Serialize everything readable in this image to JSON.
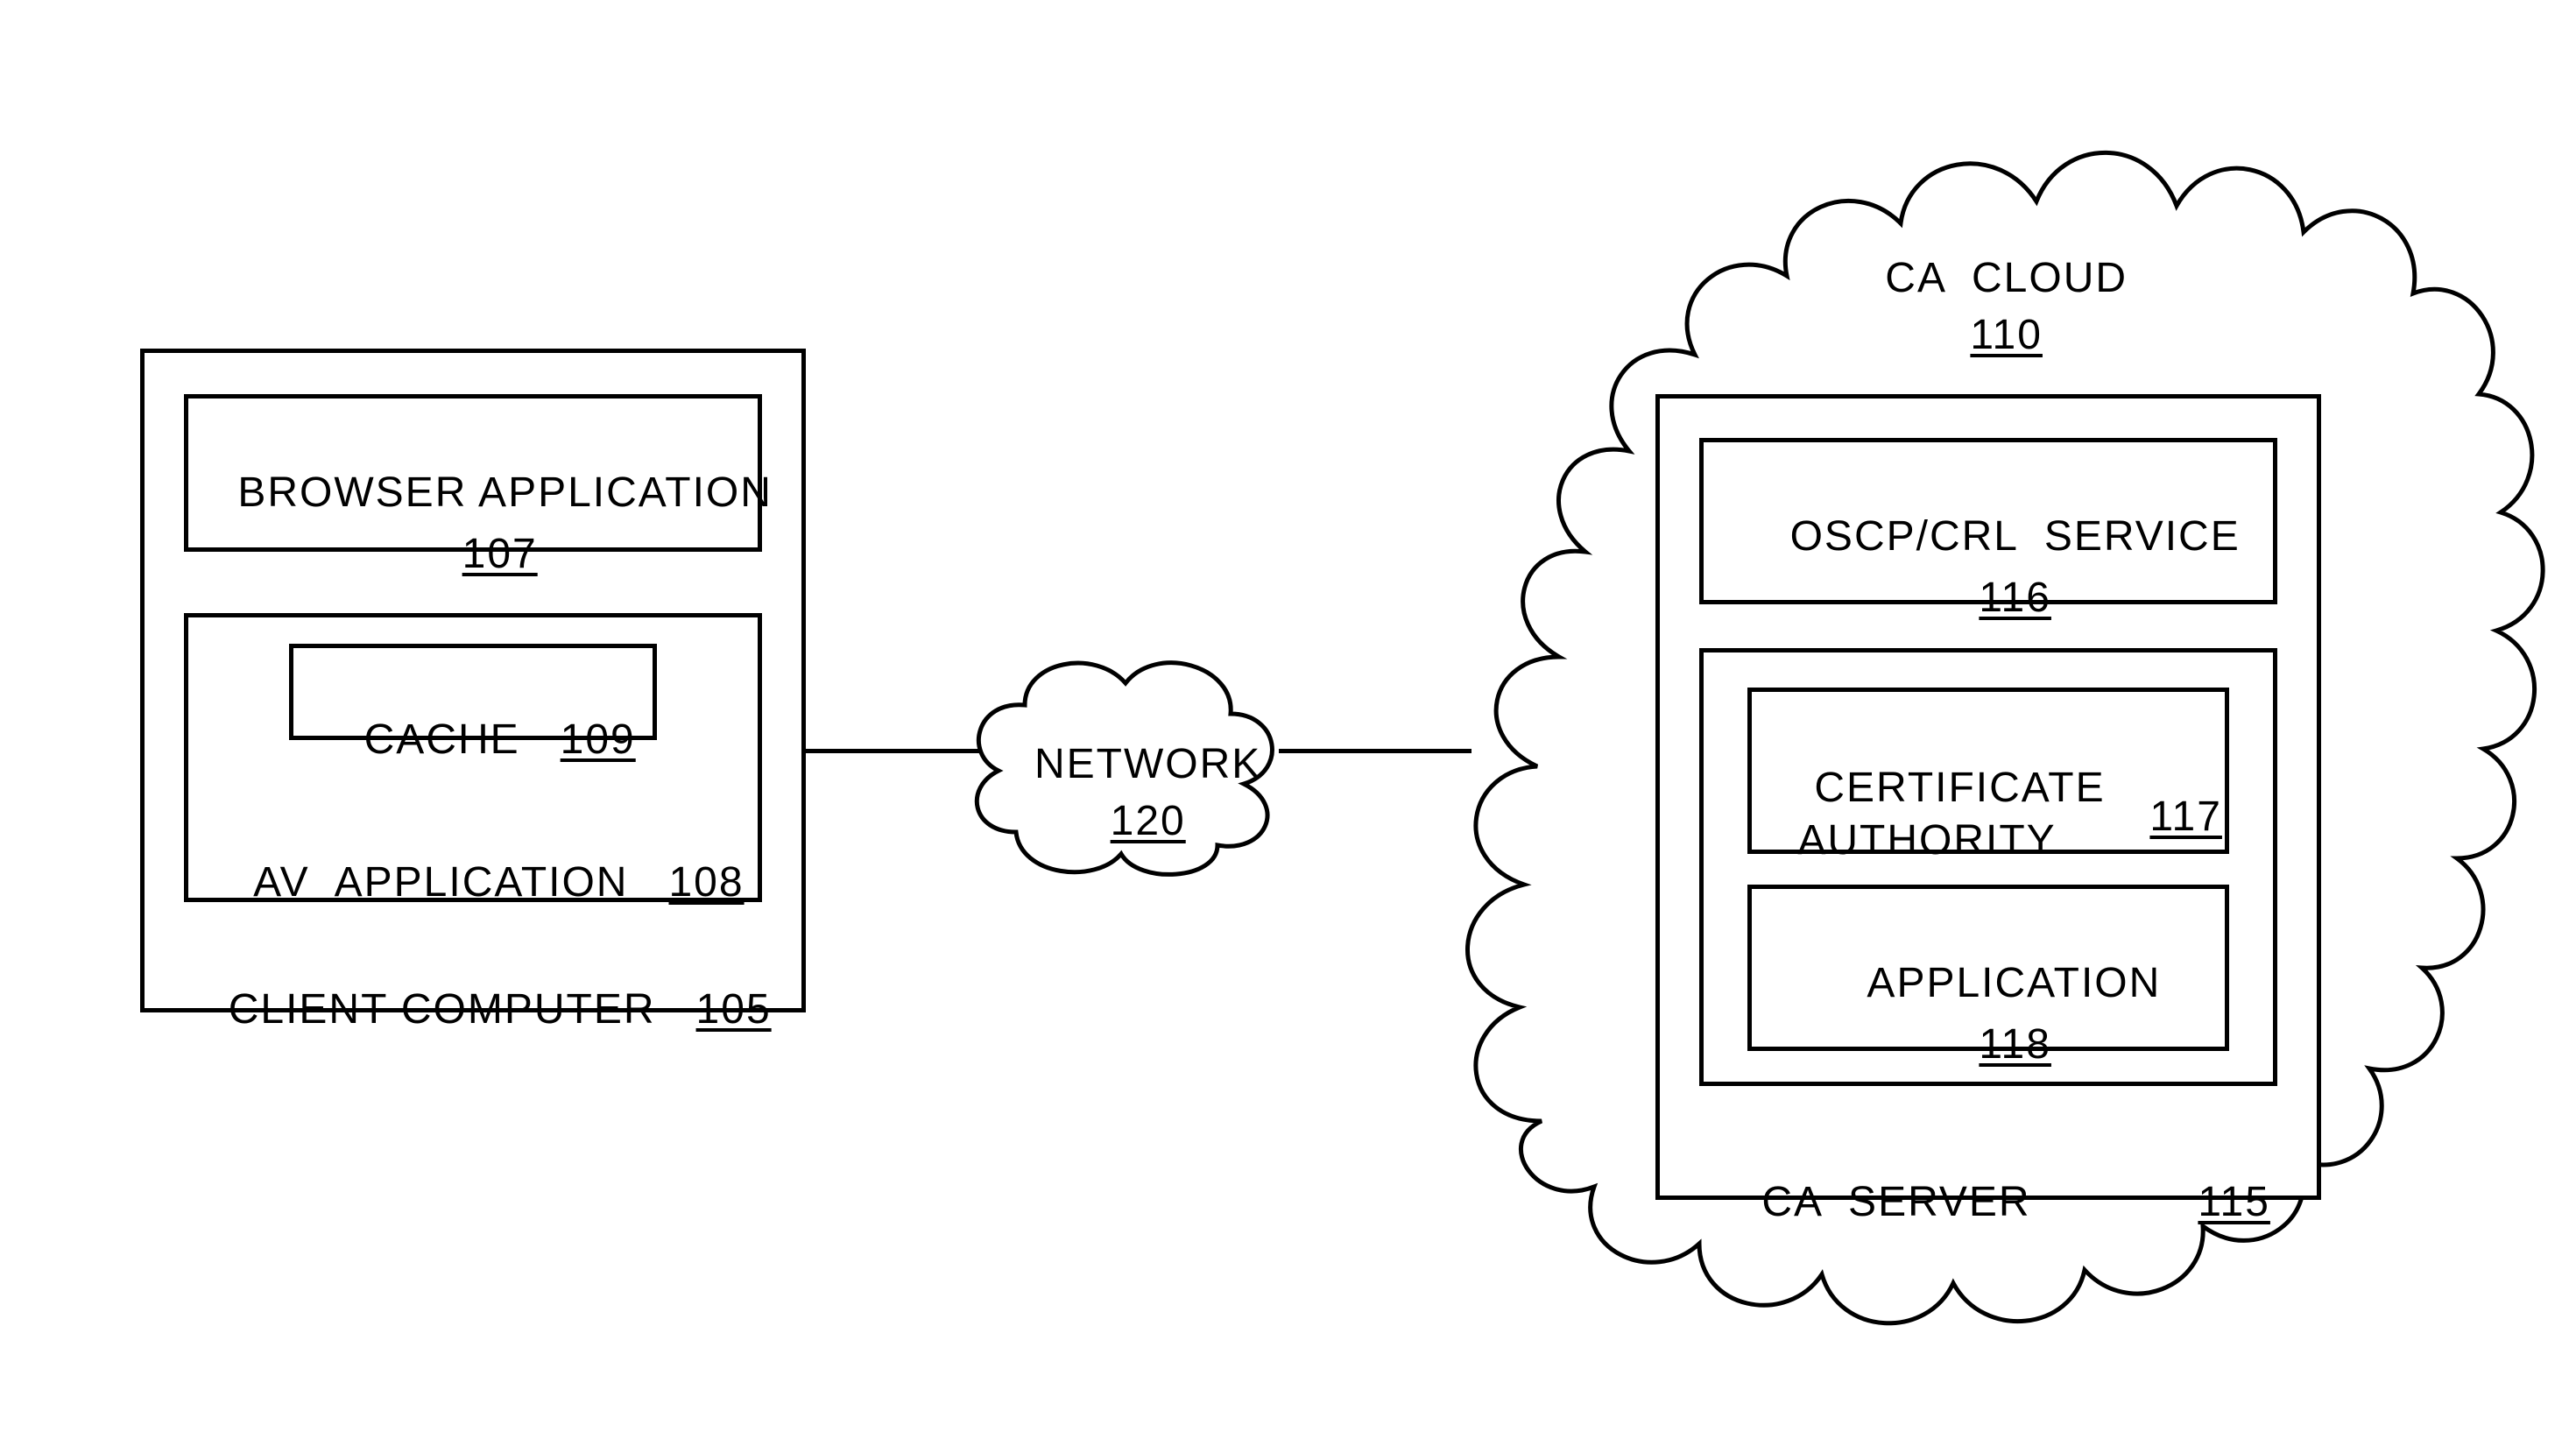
{
  "client": {
    "title": "CLIENT COMPUTER",
    "num": "105",
    "browser": {
      "title": "BROWSER APPLICATION",
      "num": "107"
    },
    "av": {
      "title": "AV  APPLICATION",
      "num": "108",
      "cache": {
        "title": "CACHE",
        "num": "109"
      }
    }
  },
  "network": {
    "title": "NETWORK",
    "num": "120"
  },
  "cloud": {
    "title": "CA  CLOUD",
    "num": "110",
    "server": {
      "title": "CA  SERVER",
      "num": "115",
      "ocsp": {
        "title": "OSCP/CRL  SERVICE",
        "num": "116"
      },
      "inner": {
        "ca": {
          "title": "CERTIFICATE\nAUTHORITY",
          "num": "117"
        },
        "app": {
          "title": "APPLICATION",
          "num": "118"
        }
      }
    }
  }
}
